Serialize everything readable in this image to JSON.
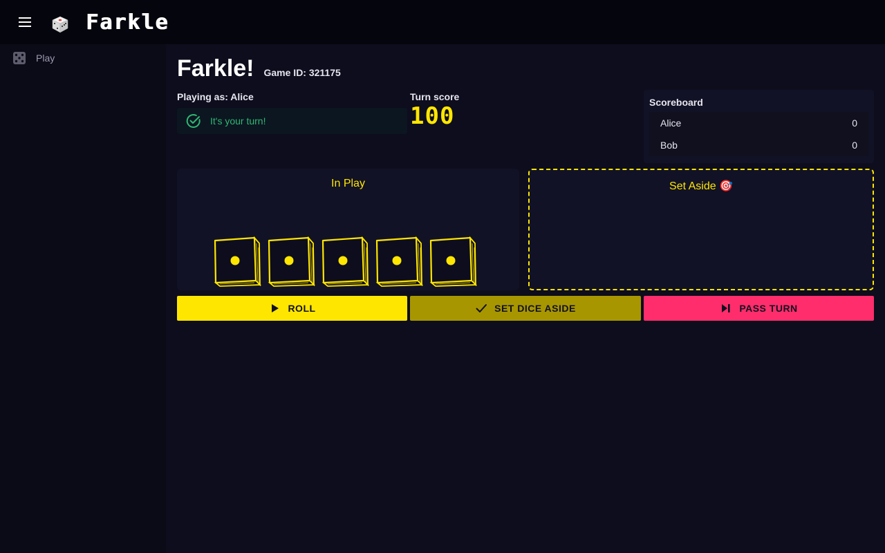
{
  "app": {
    "title": "Farkle",
    "logo_icon": "dice-icon"
  },
  "sidebar": {
    "items": [
      {
        "label": "Play",
        "icon": "dice-five-icon"
      }
    ]
  },
  "main": {
    "title": "Farkle!",
    "game_id": "Game ID: 321175",
    "playing_as_prefix": "Playing as:",
    "player_name": "Alice",
    "turn_message": "It's your turn!",
    "turn_score_label": "Turn score",
    "turn_score": "100"
  },
  "scoreboard": {
    "title": "Scoreboard",
    "rows": [
      {
        "name": "Alice",
        "score": "0"
      },
      {
        "name": "Bob",
        "score": "0"
      }
    ]
  },
  "panels": {
    "in_play_title": "In Play",
    "set_aside_title": "Set Aside 🎯",
    "in_play_dice": [
      1,
      1,
      1,
      1,
      1
    ],
    "set_aside_dice": []
  },
  "actions": {
    "roll": "ROLL",
    "set_aside": "SET DICE ASIDE",
    "pass_turn": "PASS TURN"
  },
  "colors": {
    "accent_yellow": "#ffe600",
    "pass_pink": "#ff2d6b",
    "success_green": "#2fb873",
    "background": "#0b0b18"
  }
}
